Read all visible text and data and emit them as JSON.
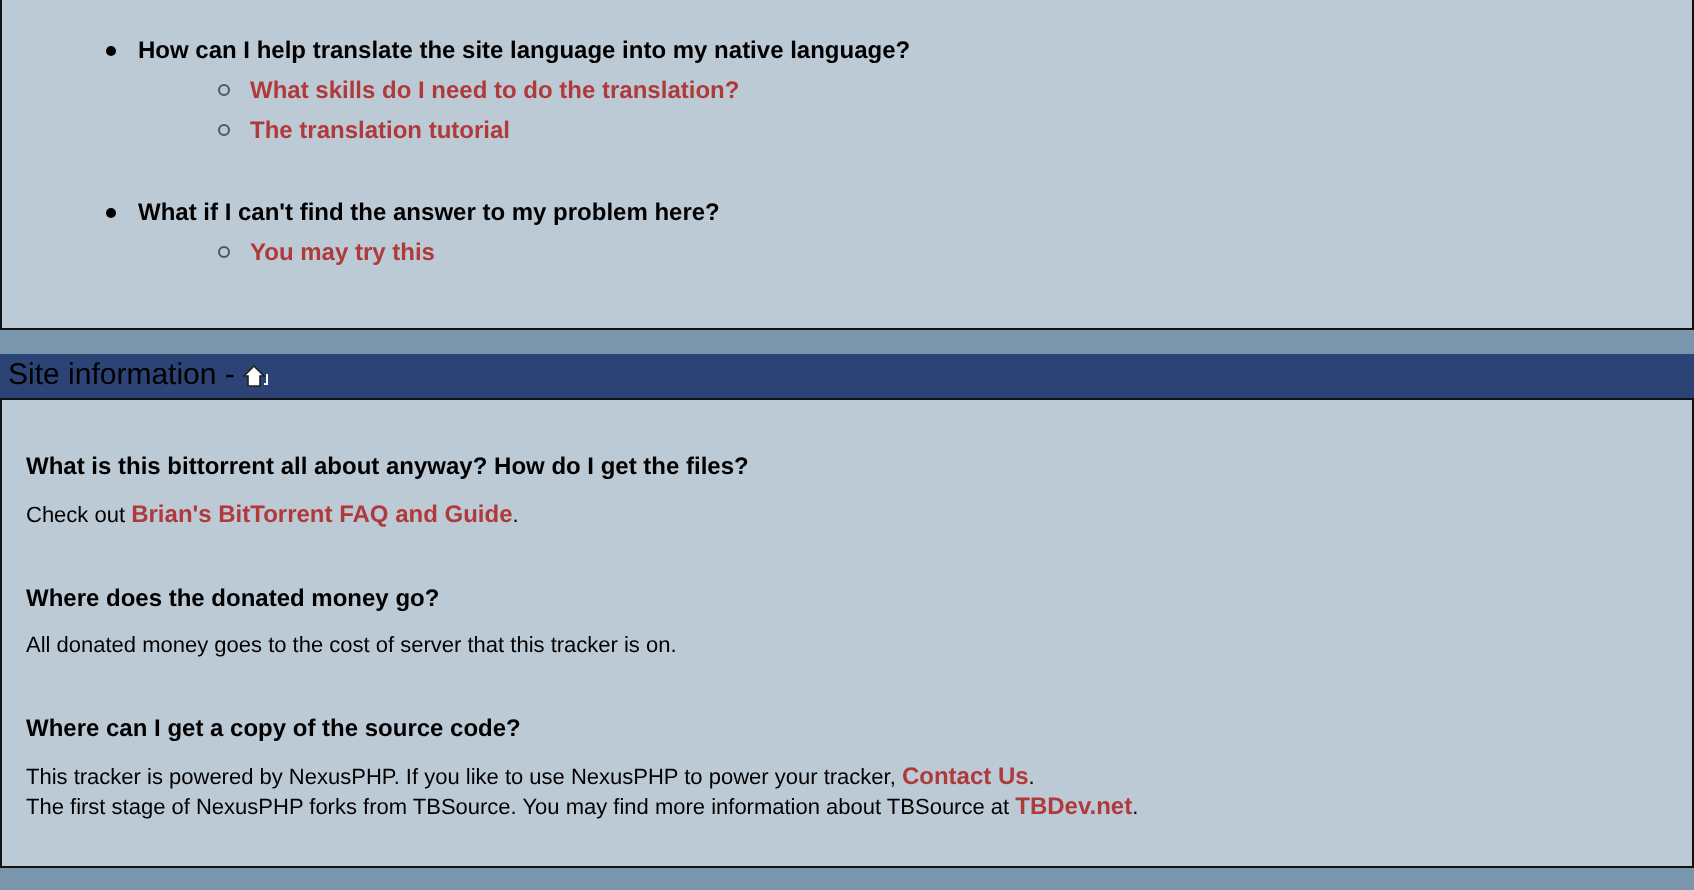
{
  "faq_list": [
    {
      "question": "How can I help translate the site language into my native language?",
      "links": [
        "What skills do I need to do the translation?",
        "The translation tutorial"
      ]
    },
    {
      "question": "What if I can't find the answer to my problem here?",
      "links": [
        "You may try this"
      ]
    }
  ],
  "section": {
    "title": "Site information -",
    "entries": [
      {
        "question": "What is this bittorrent all about anyway? How do I get the files?",
        "lines": [
          [
            {
              "kind": "text",
              "text": "Check out "
            },
            {
              "kind": "link",
              "text": "Brian's BitTorrent FAQ and Guide"
            },
            {
              "kind": "text",
              "text": "."
            }
          ]
        ]
      },
      {
        "question": "Where does the donated money go?",
        "lines": [
          [
            {
              "kind": "text",
              "text": "All donated money goes to the cost of server that this tracker is on."
            }
          ]
        ]
      },
      {
        "question": "Where can I get a copy of the source code?",
        "lines": [
          [
            {
              "kind": "text",
              "text": "This tracker is powered by NexusPHP. If you like to use NexusPHP to power your tracker, "
            },
            {
              "kind": "link",
              "text": "Contact Us"
            },
            {
              "kind": "text",
              "text": "."
            }
          ],
          [
            {
              "kind": "text",
              "text": "The first stage of NexusPHP forks from TBSource. You may find more information about TBSource at "
            },
            {
              "kind": "link",
              "text": "TBDev.net"
            },
            {
              "kind": "text",
              "text": "."
            }
          ]
        ]
      }
    ]
  }
}
